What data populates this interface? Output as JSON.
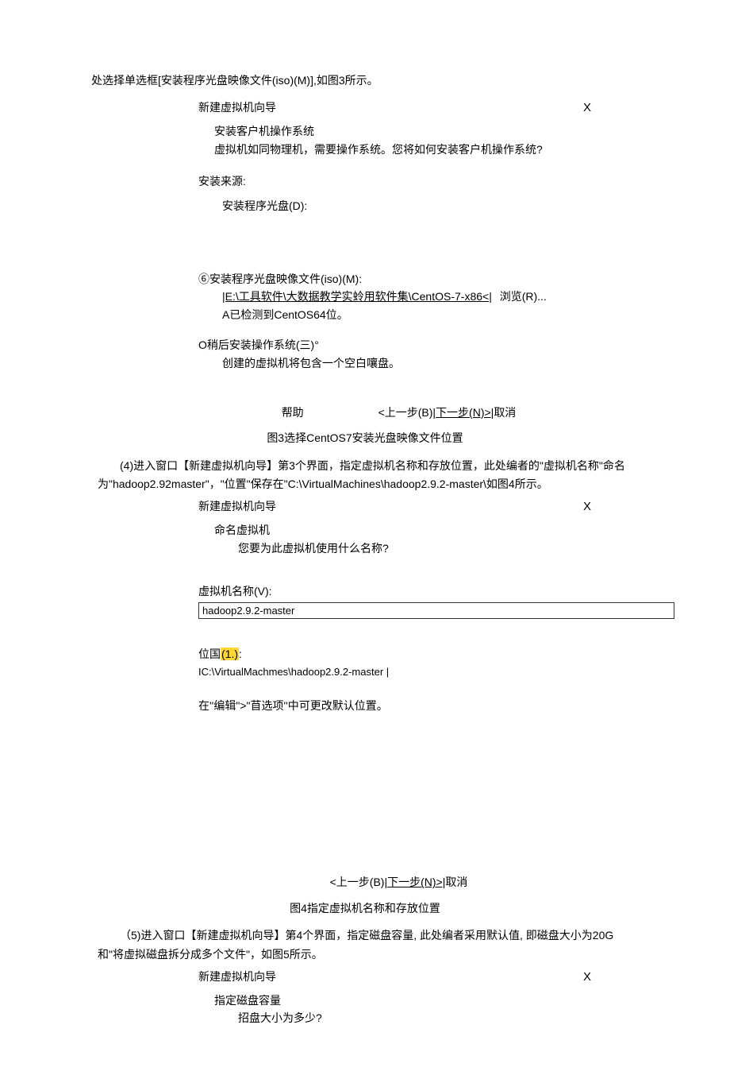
{
  "intro": "处选择单选框[安装程序光盘映像文件(iso)(M)],如图3所示。",
  "wizard3": {
    "title": "新建虚拟机向导",
    "close": "X",
    "subtitle": "安装客户机操作系统",
    "subdesc": "虚拟机如同物理机，需要操作系统。您将如何安装客户机操作系统?",
    "source_label": "安装来源:",
    "opt_disc": "安装程序光盘(D):",
    "opt_iso": "⑥安装程序光盘映像文件(iso)(M):",
    "iso_path": "|E:\\工具软件\\大数据教学实蛉用软件集\\CentOS-7-x86<|",
    "browse": "浏览(R)...",
    "detected": "A已检测到CentOS64位。",
    "opt_later": "O稍后安装操作系统(三)°",
    "later_desc": "创建的虚拟机将包含一个空白嚷盘。",
    "help": "帮助",
    "prev": "<上一步(B)|",
    "next": "下一步(N)>|",
    "cancel": "取消"
  },
  "caption3": "图3选择CentOS7安装光盘映像文件位置",
  "para4": "(4)进入窗口【新建虚拟机向导】第3个界面，指定虚拟机名称和存放位置，此处编者的\"虚拟机名称\"命名为\"hadoop2.92master\"，\"位置\"保存在\"C:\\VirtualMachines\\hadoop2.9.2-master\\如图4所示。",
  "wizard4": {
    "title": "新建虚拟机向导",
    "close": "X",
    "subtitle": "命名虚拟机",
    "subdesc": "您要为此虚拟机使用什么名称?",
    "name_label": "虚拟机名称(V):",
    "name_value": "hadoop2.9.2-master",
    "loc_label_pre": "位国",
    "loc_label_hl": "(1.)",
    "loc_label_post": ":",
    "loc_value": "IC:\\VirtualMachmes\\hadoop2.9.2-master |",
    "note": "在''编辑\">\"苜选项''中可更改默认位置。",
    "prev": "<上一步(B)|",
    "next": "下一步(N)>|",
    "cancel": "取消"
  },
  "caption4": "图4指定虚拟机名称和存放位置",
  "para5": "（5)进入窗口【新建虚拟机向导】第4个界面，指定磁盘容量, 此处编者采用默认值, 即磁盘大小为20G和\"将虚拟磁盘拆分成多个文件\"，如图5所示。",
  "wizard5": {
    "title": "新建虚拟机向导",
    "close": "X",
    "subtitle": "指定磁盘容量",
    "subdesc": "招盘大小为多少?"
  }
}
